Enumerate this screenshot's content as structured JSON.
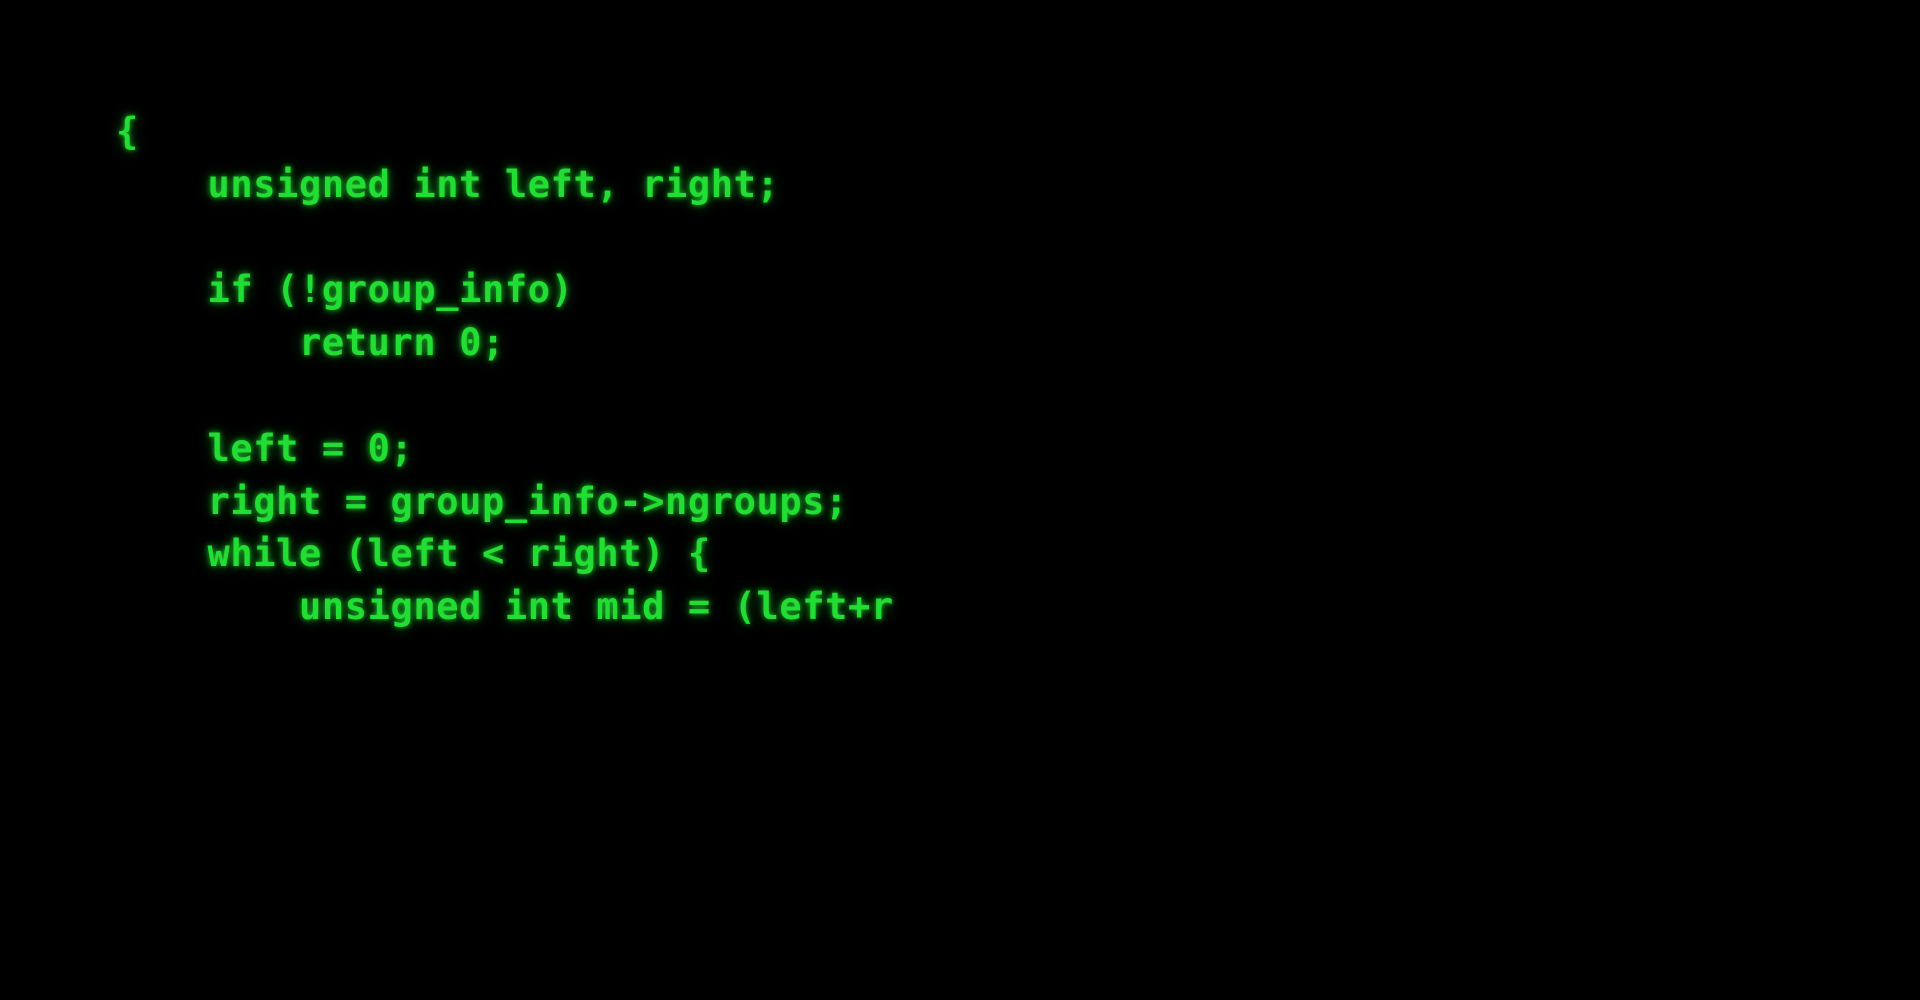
{
  "terminal": {
    "text_color": "#22dd33",
    "background_color": "#000000",
    "lines": [
      "{",
      "    unsigned int left, right;",
      "",
      "    if (!group_info)",
      "        return 0;",
      "",
      "    left = 0;",
      "    right = group_info->ngroups;",
      "    while (left < right) {",
      "        unsigned int mid = (left+r"
    ]
  }
}
